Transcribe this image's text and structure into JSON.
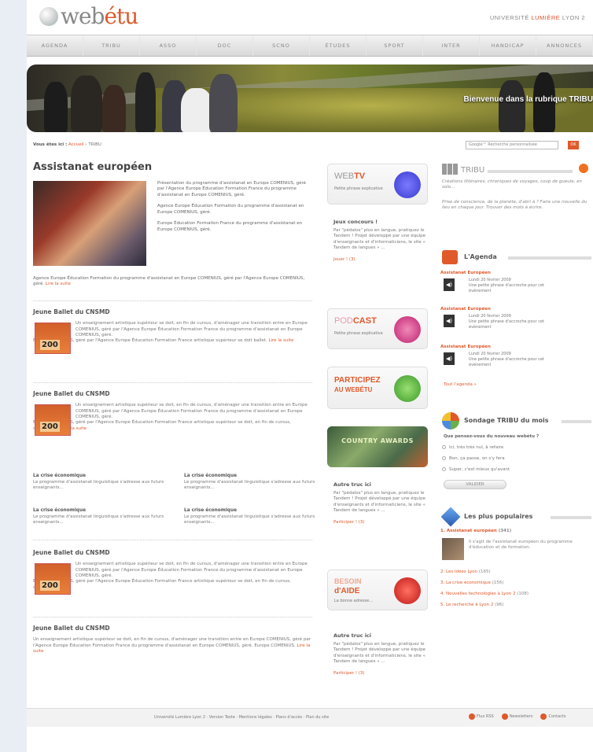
{
  "header": {
    "logo_text_a": "web",
    "logo_text_b": "étu",
    "logo_sub": "LE MAG",
    "univ_a": "UNIVERSITÉ",
    "univ_b": "LUMIÈRE",
    "univ_c": "LYON 2"
  },
  "nav": [
    "AGENDA",
    "TRIBU",
    "ASSO",
    "DOC",
    "SCNO",
    "ÉTUDES",
    "SPORT",
    "INTER",
    "HANDICAP",
    "ANNONCES"
  ],
  "banner": {
    "caption": "Bienvenue dans la rubrique TRIBU"
  },
  "breadcrumb": {
    "label": "Vous êtes ici :",
    "home": "Accueil",
    "current": "TRIBU"
  },
  "search": {
    "placeholder": "Google™ Recherche personnalisée",
    "button": "OK"
  },
  "main": {
    "title": "Assistanat européen",
    "feat_p1": "Présentation du programme d'assistanat en Europe COMENIUS, géré par l'Agence Europe Éducation Formation France du programme d'assistanat en Europe COMENIUS, géré.",
    "feat_p2": "Agence Europe Éducation Formation du programme d'assistanat en Europe COMENIUS, géré.",
    "feat_p3": "Europe Éducation Formation France du programme d'assistanat en Europe COMENIUS, géré.",
    "feat_bottom": "Agence Europe Éducation Formation du programme d'assistanat en Europe COMENIUS, géré par l'Agence Europe COMENIUS, géré.",
    "more": "Lire la suite",
    "articles": [
      {
        "title": "Jeune Ballet du CNSMD",
        "body": "Un enseignement artistique supérieur se doit, en fin de cursus, d'aménager une transition entre en Europe COMENIUS, géré par l'Agence Europe Éducation Formation France du programme d'assistanat en Europe COMENIUS, géré.",
        "tail": "Europe COMENIUS, géré par l'Agence Europe Éducation Formation France artistique supérieur se doit ballet.",
        "year": "200"
      },
      {
        "title": "Jeune Ballet du CNSMD",
        "body": "Un enseignement artistique supérieur se doit, en fin de cursus, d'aménager une transition entre en Europe COMENIUS, géré par l'Agence Europe Éducation Formation France du programme d'assistanat en Europe COMENIUS, géré.",
        "tail": "Europe COMENIUS, géré par l'Agence Europe Éducation Formation France artistique supérieur se doit, en fin de cursus, d'aménager.",
        "year": "200"
      },
      {
        "title": "Jeune Ballet du CNSMD",
        "body": "Un enseignement artistique supérieur se doit, en fin de cursus, d'aménager une transition entre en Europe COMENIUS, géré par l'Agence Europe Éducation Formation France du programme d'assistanat en Europe COMENIUS, géré.",
        "tail": "Europe COMENIUS, géré par l'Agence Europe Éducation Formation France artistique supérieur se doit, en fin de cursus, d'aménager.",
        "year": "200"
      },
      {
        "title": "Jeune Ballet du CNSMD",
        "body": "Un enseignement artistique supérieur se doit, en fin de cursus, d'aménager une transition entre en Europe COMENIUS, géré par l'Agence Europe Éducation Formation France du programme d'assistanat en Europe COMENIUS, géré.",
        "tail": "Europe COMENIUS.",
        "year": ""
      }
    ],
    "minis": [
      {
        "title": "La crise économique",
        "body": "Le programme d'assistanat linguistique s'adresse aux futurs enseignants..."
      },
      {
        "title": "La crise économique",
        "body": "Le programme d'assistanat linguistique s'adresse aux futurs enseignants..."
      },
      {
        "title": "La crise économique",
        "body": "Le programme d'assistanat linguistique s'adresse aux futurs enseignants..."
      },
      {
        "title": "La crise économique",
        "body": "Le programme d'assistanat linguistique s'adresse aux futurs enseignants..."
      }
    ]
  },
  "mid": {
    "webtv": {
      "a": "WEB",
      "b": "TV",
      "sub": "Petite phrase explicative"
    },
    "jeux": {
      "title": "Jeux concours !",
      "body": "Par \"pédalos\" plus en langue, pratiquez le Tandem ! Projet développé par une équipe d'enseignants et d'informaticiens, le site « Tandem de langues » ...",
      "link": "Jouer ! (3)"
    },
    "podcast": {
      "a": "POD",
      "b": "CAST",
      "sub": "Petite phrase explicative"
    },
    "participez": {
      "a": "PARTICIPEZ",
      "b": "AU WEBÉTU"
    },
    "awards": "COUNTRY AWARDS",
    "autre1": {
      "title": "Autre truc ici",
      "body": "Par \"pédalos\" plus en langue, pratiquez le Tandem ! Projet développé par une équipe d'enseignants et d'informaticiens, le site « Tandem de langues » ...",
      "link": "Participer ! (3)"
    },
    "besoin": {
      "a": "BESOIN",
      "b": "d'AIDE",
      "sub": "La bonne adresse..."
    },
    "autre2": {
      "title": "Autre truc ici",
      "body": "Par \"pédalos\" plus en langue, pratiquez le Tandem ! Projet développé par une équipe d'enseignants et d'informaticiens, le site « Tandem de langues » ...",
      "link": "Participer ! (3)"
    }
  },
  "right": {
    "tribu": {
      "title": "TRIBU",
      "p1": "Créations littéraires, chroniques de voyages, coup de gueule, en solo...",
      "p2": "Prise de conscience, de la planète, d'abri à ? Faire une nouvelle du lieu en chaque jour. Trouver des mots à écrire."
    },
    "agenda": {
      "title": "L'Agenda",
      "items": [
        {
          "head": "Assistanat Européen",
          "date": "Lundi 20 février 2009",
          "text": "Une petite phrase d'accroche pour cet événement"
        },
        {
          "head": "Assistanat Européen",
          "date": "Lundi 20 février 2009",
          "text": "Une petite phrase d'accroche pour cet événement"
        },
        {
          "head": "Assistanat Européen",
          "date": "Lundi 20 février 2009",
          "text": "Une petite phrase d'accroche pour cet événement"
        }
      ],
      "all": "Tout l'agenda »"
    },
    "poll": {
      "title": "Sondage TRIBU du mois",
      "question": "Que pensez-vous du nouveau webétu ?",
      "options": [
        "Ici, très très nul, à refaire",
        "Bon, ça passe, on s'y fera",
        "Super, c'est mieux qu'avant"
      ],
      "button": "VALIDER"
    },
    "popular": {
      "title": "Les plus populaires",
      "first": "Assistanat européen",
      "first_count": "(341)",
      "first_desc": "Il s'agit de l'assistanat européen du programme d'éducation et de formation.",
      "items": [
        {
          "label": "2. Les Idées Lyon",
          "count": "(165)"
        },
        {
          "label": "3. La crise économique",
          "count": "(156)"
        },
        {
          "label": "4. Nouvelles technologies à Lyon 2",
          "count": "(108)"
        },
        {
          "label": "5. Le recherche à Lyon 2",
          "count": "(96)"
        }
      ]
    }
  },
  "footer": {
    "links": "Université Lumière Lyon 2 · Version Texte · Mentions légales · Plans d'accès · Plan du site",
    "icon1": "Flux RSS",
    "icon2": "Newsletters",
    "icon3": "Contacts"
  },
  "colors": {
    "accent": "#e0592a",
    "text": "#555555",
    "nav_bg": "#dcdcdc"
  }
}
